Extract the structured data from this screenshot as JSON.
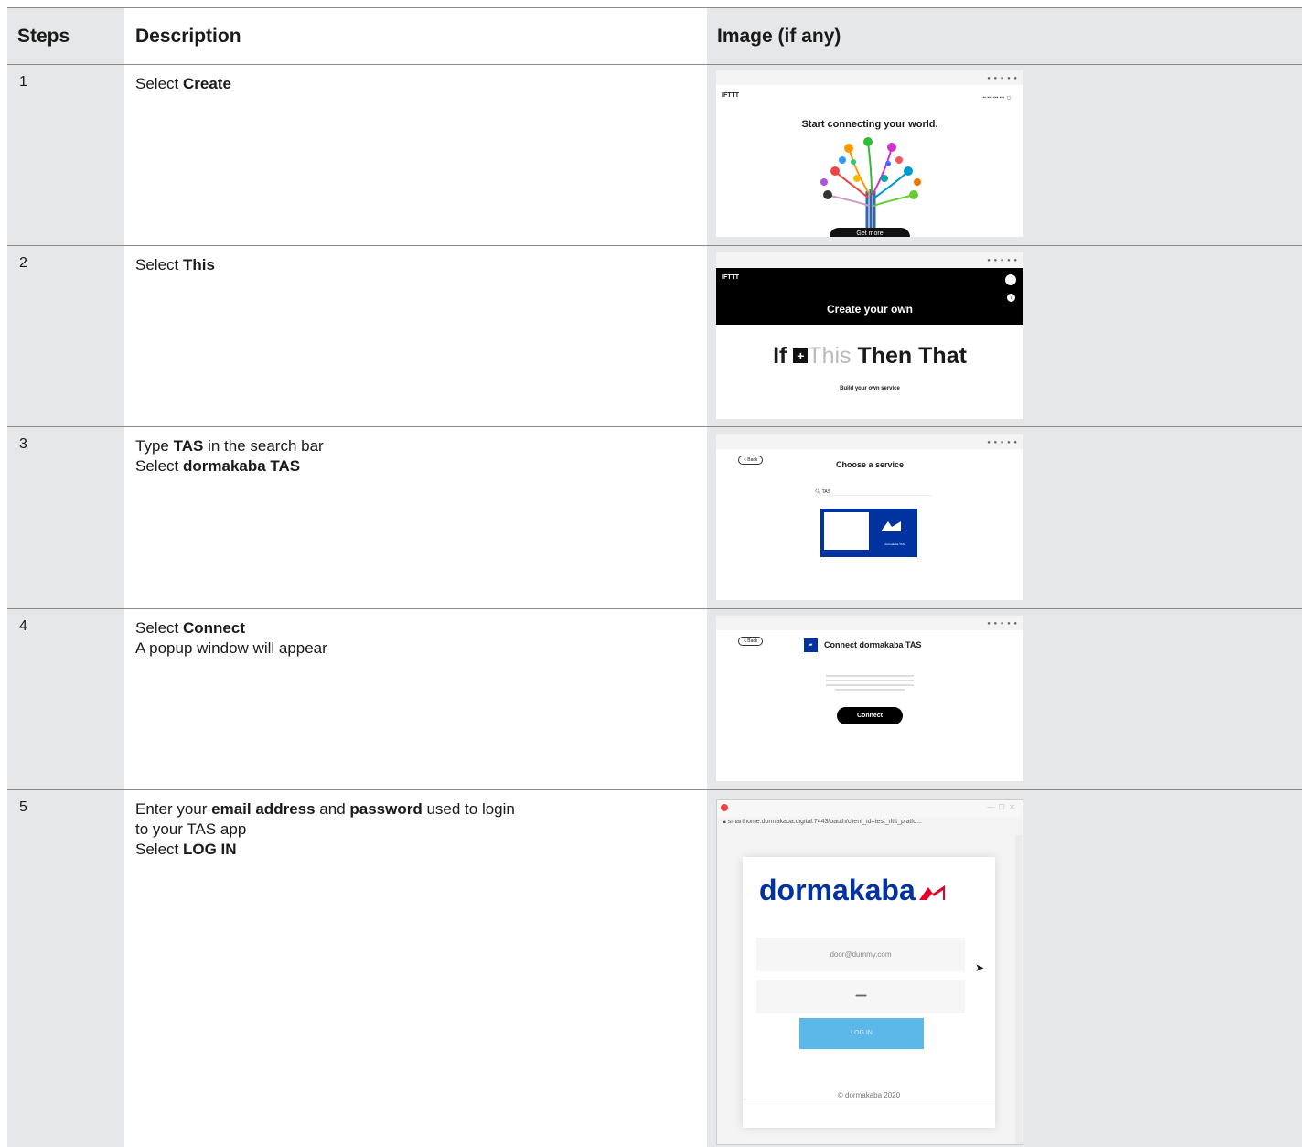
{
  "table": {
    "headers": {
      "steps": "Steps",
      "description": "Description",
      "image": "Image (if any)"
    },
    "rows": [
      {
        "step": "1",
        "lines": [
          [
            {
              "t": "Select "
            },
            {
              "t": "Create",
              "b": true
            }
          ]
        ]
      },
      {
        "step": "2",
        "lines": [
          [
            {
              "t": "Select "
            },
            {
              "t": "This",
              "b": true
            }
          ]
        ]
      },
      {
        "step": "3",
        "lines": [
          [
            {
              "t": "Type "
            },
            {
              "t": "TAS",
              "b": true
            },
            {
              "t": " in the search bar"
            }
          ],
          [
            {
              "t": "Select "
            },
            {
              "t": "dormakaba TAS",
              "b": true
            }
          ]
        ]
      },
      {
        "step": "4",
        "lines": [
          [
            {
              "t": "Select "
            },
            {
              "t": "Connect",
              "b": true
            }
          ],
          [
            {
              "t": "A popup window will appear"
            }
          ]
        ]
      },
      {
        "step": "5",
        "lines": [
          [
            {
              "t": "Enter your "
            },
            {
              "t": "email address",
              "b": true
            },
            {
              "t": " and "
            },
            {
              "t": "password",
              "b": true
            },
            {
              "t": " used to login"
            }
          ],
          [
            {
              "t": "to your TAS app"
            }
          ],
          [
            {
              "t": "Select "
            },
            {
              "t": "LOG IN",
              "b": true
            }
          ]
        ]
      }
    ]
  },
  "shots": {
    "s1": {
      "logo": "IFTTT",
      "title": "Start connecting your world.",
      "button": "Get more"
    },
    "s2": {
      "logo": "IFTTT",
      "banner": "Create your own",
      "if": "If",
      "this": "This",
      "then": "Then That",
      "sub": "Build your own service"
    },
    "s3": {
      "back": "< Back",
      "title": "Choose a service",
      "search": "TAS",
      "tile": "dormakaba TAS"
    },
    "s4": {
      "back": "< Back",
      "title": "Connect dormakaba TAS",
      "button": "Connect"
    },
    "s5": {
      "url": "smarthome.dormakaba.digital:7443/oauth/client_id=test_ifttt_platfo...",
      "brand": "dormakaba",
      "email": "door@dummy.com",
      "password": "••••••••",
      "login": "LOG IN",
      "footer": "© dormakaba 2020"
    }
  },
  "colors": {
    "column_gray": "#e6e7e8",
    "dormakaba_blue": "#0033a0",
    "dormakaba_red": "#e4002b",
    "login_blue": "#5bb8e8"
  }
}
